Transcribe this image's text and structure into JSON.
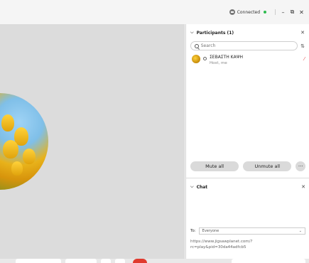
{
  "titlebar": {
    "status_text": "Connected",
    "status_color": "#2dbb4e",
    "controls": {
      "minimize": "–",
      "restore": "⧉",
      "close": "✕"
    }
  },
  "participants_panel": {
    "title": "Participants (1)",
    "search_placeholder": "Search",
    "participants": [
      {
        "name": "ΣΕΒΑΣΤΗ ΚΑΨΗ",
        "role": "Host, me",
        "mic_icon": "mic-off-icon"
      }
    ],
    "mute_all_label": "Mute all",
    "unmute_all_label": "Unmute all",
    "more_label": "···"
  },
  "chat_panel": {
    "title": "Chat",
    "to_label": "To:",
    "to_value": "Everyone",
    "draft_text": "https://www.jigsawplanet.com/?rc=play&pid=30da44adfcb5"
  }
}
